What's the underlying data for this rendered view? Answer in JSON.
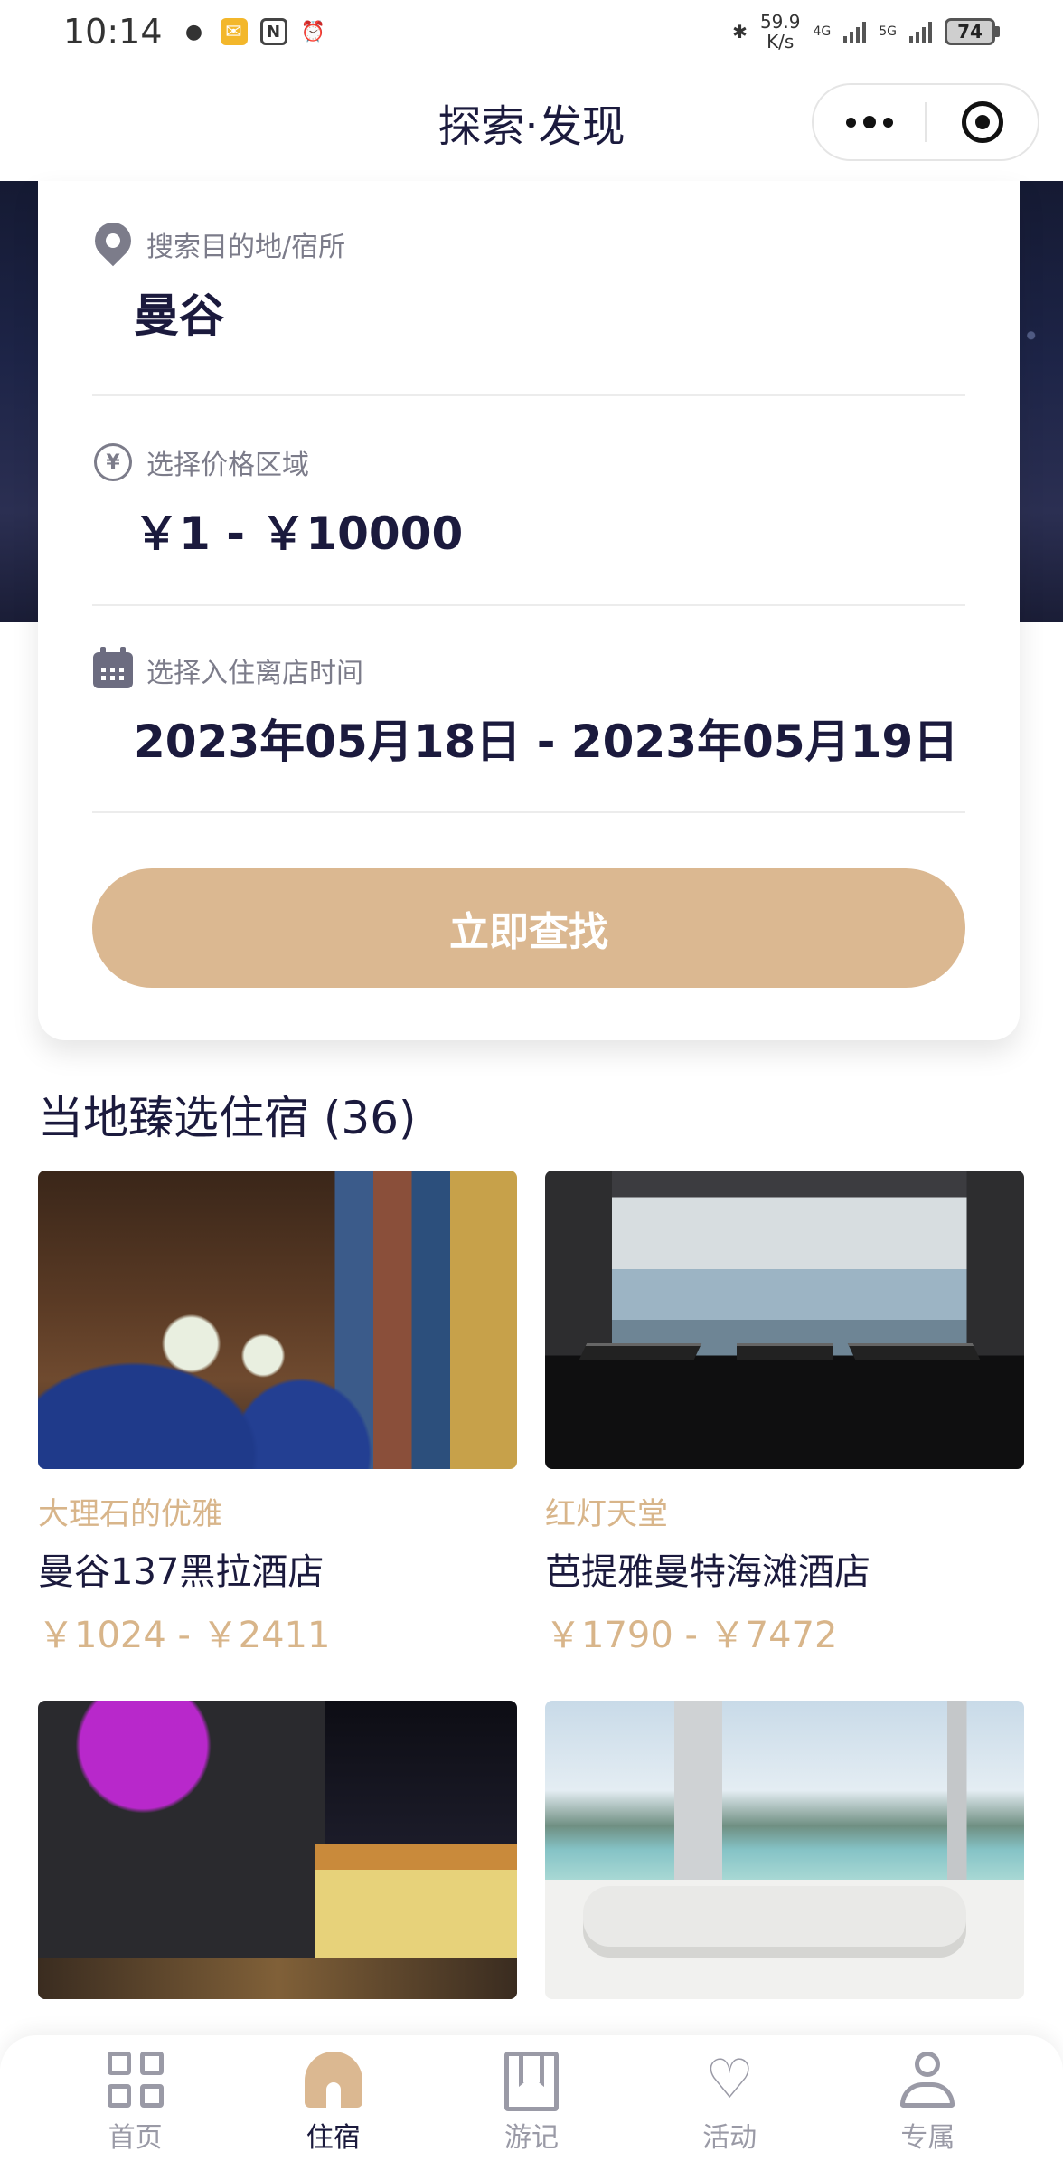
{
  "status_bar": {
    "time": "10:14",
    "net_speed_value": "59.9",
    "net_speed_unit": "K/s",
    "signal_1": "4G",
    "signal_2": "5G",
    "battery": "74"
  },
  "nav": {
    "title": "探索·发现"
  },
  "search": {
    "destination_label": "搜索目的地/宿所",
    "destination_value": "曼谷",
    "price_label": "选择价格区域",
    "price_value": "￥1 - ￥10000",
    "date_label": "选择入住离店时间",
    "date_value": "2023年05月18日 - 2023年05月19日",
    "button_label": "立即查找"
  },
  "section": {
    "title": "当地臻选住宿 (36)"
  },
  "hotels": [
    {
      "tag": "大理石的优雅",
      "name": "曼谷137黑拉酒店",
      "price": "￥1024 - ￥2411"
    },
    {
      "tag": "红灯天堂",
      "name": "芭提雅曼特海滩酒店",
      "price": "￥1790 - ￥7472"
    }
  ],
  "tabs": [
    {
      "label": "首页",
      "icon": "grid-icon"
    },
    {
      "label": "住宿",
      "icon": "house-icon"
    },
    {
      "label": "游记",
      "icon": "bookmark-icon"
    },
    {
      "label": "活动",
      "icon": "heart-icon"
    },
    {
      "label": "专属",
      "icon": "user-icon"
    }
  ],
  "colors": {
    "accent": "#dbb891",
    "primary_text": "#1b1a3d",
    "muted_text": "#9a9aa6"
  }
}
